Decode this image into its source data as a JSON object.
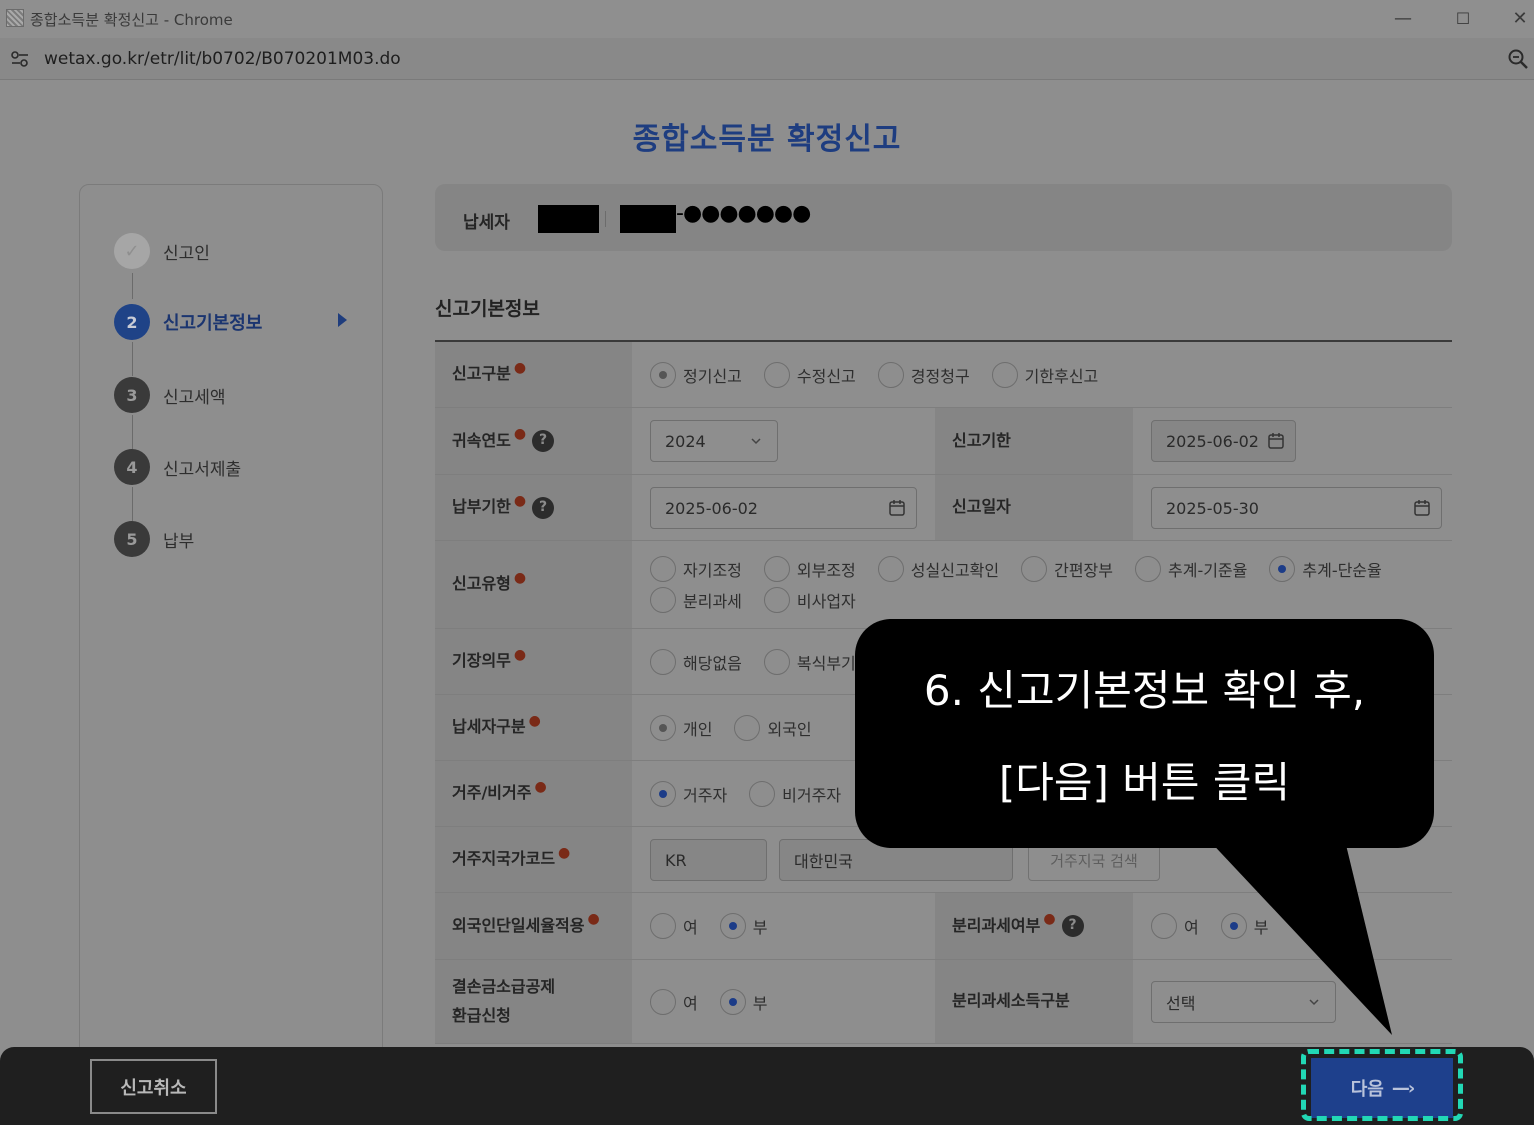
{
  "browser": {
    "window_title": "종합소득분 확정신고 - Chrome",
    "url": "wetax.go.kr/etr/lit/b0702/B070201M03.do",
    "controls": {
      "minimize": "—",
      "maximize": "☐",
      "close": "✕"
    }
  },
  "page": {
    "title": "종합소득분 확정신고"
  },
  "steps": [
    {
      "num": "✓",
      "label": "신고인",
      "state": "done"
    },
    {
      "num": "2",
      "label": "신고기본정보",
      "state": "active"
    },
    {
      "num": "3",
      "label": "신고세액",
      "state": "todo"
    },
    {
      "num": "4",
      "label": "신고서제출",
      "state": "todo"
    },
    {
      "num": "5",
      "label": "납부",
      "state": "todo"
    }
  ],
  "taxpayer": {
    "label": "납세자",
    "masked_id": "-●●●●●●●"
  },
  "section": {
    "title": "신고기본정보"
  },
  "form": {
    "report_type": {
      "label": "신고구분",
      "options": [
        "정기신고",
        "수정신고",
        "경정청구",
        "기한후신고"
      ],
      "selected": "정기신고"
    },
    "tax_year": {
      "label": "귀속연도",
      "value": "2024"
    },
    "report_deadline": {
      "label": "신고기한",
      "value": "2025-06-02"
    },
    "payment_deadline": {
      "label": "납부기한",
      "value": "2025-06-02"
    },
    "report_date": {
      "label": "신고일자",
      "value": "2025-05-30"
    },
    "report_category": {
      "label": "신고유형",
      "options": [
        "자기조정",
        "외부조정",
        "성실신고확인",
        "간편장부",
        "추계-기준율",
        "추계-단순율",
        "분리과세",
        "비사업자"
      ],
      "selected": "추계-단순율"
    },
    "bookkeeping": {
      "label": "기장의무",
      "options": [
        "해당없음",
        "복식부기"
      ]
    },
    "taxpayer_type": {
      "label": "납세자구분",
      "options": [
        "개인",
        "외국인"
      ],
      "selected": "개인"
    },
    "residency": {
      "label": "거주/비거주",
      "options": [
        "거주자",
        "비거주자"
      ],
      "selected": "거주자"
    },
    "country_code": {
      "label": "거주지국가코드",
      "code": "KR",
      "name": "대한민국",
      "search_label": "거주지국 검색"
    },
    "foreign_flat_rate": {
      "label": "외국인단일세율적용",
      "options": [
        "여",
        "부"
      ],
      "selected": "부"
    },
    "separate_tax": {
      "label": "분리과세여부",
      "options": [
        "여",
        "부"
      ],
      "selected": "부"
    },
    "loss_refund": {
      "label_line1": "결손금소급공제",
      "label_line2": "환급신청",
      "options": [
        "여",
        "부"
      ],
      "selected": "부"
    },
    "separate_income_type": {
      "label": "분리과세소득구분",
      "value": "선택"
    }
  },
  "actions": {
    "cancel": "신고취소",
    "next": "다음",
    "next_arrow": "—›"
  },
  "callout": {
    "line1": "6. 신고기본정보 확인 후,",
    "line2": "[다음] 버튼 클릭"
  },
  "colors": {
    "brand": "#1e408c",
    "highlight": "#22d8b5",
    "required": "#7a2a17"
  }
}
